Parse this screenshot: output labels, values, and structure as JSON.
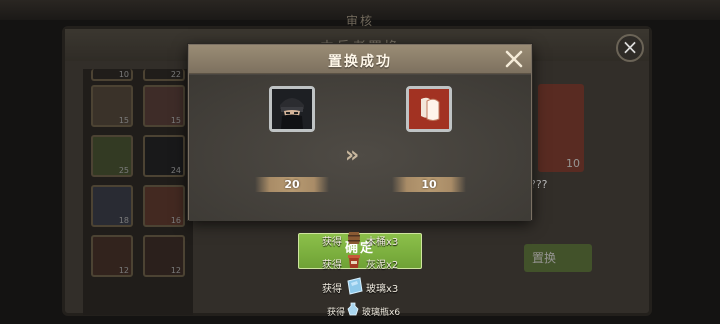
{
  "background": {
    "title": "审核",
    "panel_title": "中兵者置换",
    "grid_counts": [
      "10",
      "22",
      "15",
      "15",
      "25",
      "24",
      "18",
      "16",
      "12",
      "12"
    ],
    "right_card_count": "10",
    "right_card_text": "???",
    "right_button_label": "置换"
  },
  "dialog": {
    "title": "置换成功",
    "from_item": {
      "count": "20",
      "icon": "masked-soldier-portrait-icon"
    },
    "to_item": {
      "count": "10",
      "icon": "red-heads-silhouette-icon"
    },
    "arrow": "»",
    "confirm_label": "确定"
  },
  "rewards": [
    {
      "prefix": "获得",
      "name": "木桶x3",
      "icon": "wooden-barrel-icon"
    },
    {
      "prefix": "获得",
      "name": "灰泥x2",
      "icon": "mortar-bucket-icon"
    },
    {
      "prefix": "获得",
      "name": "玻璃x3",
      "icon": "glass-pane-icon"
    },
    {
      "prefix": "获得",
      "name": "玻璃瓶x6",
      "icon": "glass-bottle-icon"
    }
  ],
  "colors": {
    "confirm_green": "#7fb33f",
    "to_item_red": "#a23222",
    "dialog_header": "#8d806b"
  }
}
